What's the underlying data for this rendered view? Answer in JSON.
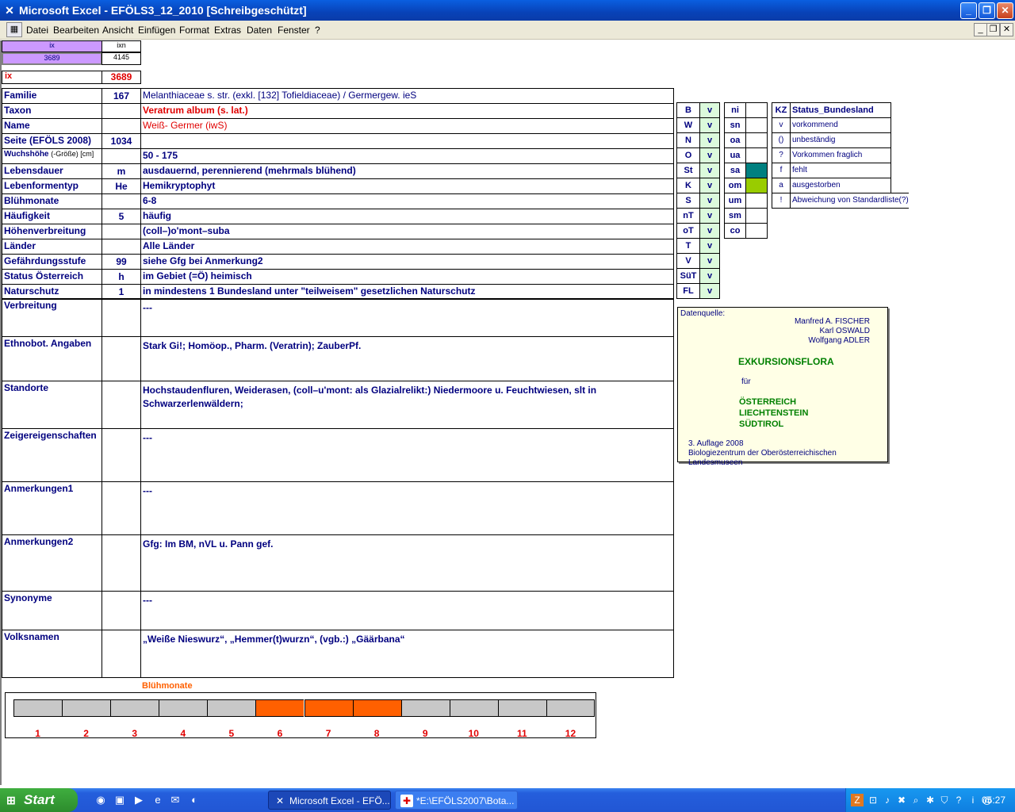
{
  "window": {
    "title": "Microsoft Excel - EFÖLS3_12_2010  [Schreibgeschützt]"
  },
  "menu": [
    "Datei",
    "Bearbeiten",
    "Ansicht",
    "Einfügen",
    "Format",
    "Extras",
    "Daten",
    "Fenster",
    "?"
  ],
  "header": {
    "ix_label": "ix",
    "ixn_label": "ixn",
    "ix_value": "3689",
    "ixn_value": "4145",
    "ix_big_label": "ix",
    "ix_big_value": "3689"
  },
  "rows": [
    {
      "label": "Familie",
      "code": "167",
      "value": "Melanthiaceae s. str. (exkl. [132] Tofieldiaceae)  /  Germergew. ieS"
    },
    {
      "label": "Taxon",
      "code": "",
      "value": "Veratrum album (s. lat.)"
    },
    {
      "label": "Name",
      "code": "",
      "value": "Weiß- Germer (iwS)"
    },
    {
      "label": "Seite (EFÖLS 2008)",
      "code": "1034",
      "value": ""
    },
    {
      "label": "Wuchshöhe",
      "label_small": "(-Größe) [cm]",
      "code": "",
      "value": " 50 - 175"
    },
    {
      "label": "Lebensdauer",
      "code": "m",
      "value": "ausdauernd, perennierend (mehrmals blühend)"
    },
    {
      "label": "Lebenformentyp",
      "code": "He",
      "value": "Hemikryptophyt"
    },
    {
      "label": "Blühmonate",
      "code": "",
      "value": " 6-8"
    },
    {
      "label": "Häufigkeit",
      "code": "5",
      "value": "häufig"
    },
    {
      "label": "Höhenverbreitung",
      "code": "",
      "value": "(coll–)o'mont–suba"
    },
    {
      "label": "Länder",
      "code": "",
      "value": "Alle Länder"
    },
    {
      "label": "Gefährdungsstufe",
      "code": "99",
      "value": "siehe Gfg bei Anmerkung2"
    },
    {
      "label": "Status Österreich",
      "code": "h",
      "value": "im Gebiet (=Ö) heimisch"
    },
    {
      "label": "Naturschutz",
      "code": "1",
      "value": "in mindestens 1 Bundesland unter \"teilweisem\" gesetzlichen Naturschutz"
    }
  ],
  "big_rows": [
    {
      "label": "Verbreitung",
      "value": " ---"
    },
    {
      "label": "Ethnobot. Angaben",
      "value": "Stark Gi!; Homöop., Pharm. (Veratrin); ZauberPf."
    },
    {
      "label": "Standorte",
      "value": "Hochstaudenfluren, Weiderasen, (coll–u'mont: als Glazialrelikt:) Niedermoore u. Feuchtwiesen, slt in Schwarzerlenwäldern;"
    },
    {
      "label": "Zeigereigenschaften",
      "value": "---"
    },
    {
      "label": "Anmerkungen1",
      "value": "---"
    },
    {
      "label": "Anmerkungen2",
      "value": "Gfg: Im BM, nVL u. Pann gef."
    },
    {
      "label": "Synonyme",
      "value": "---"
    },
    {
      "label": "Volksnamen",
      "value": "„Weiße Nieswurz“, „Hemmer(t)wurzn“, (vgb.:) „Gäärbana“"
    }
  ],
  "states": [
    {
      "code": "B",
      "v": "v"
    },
    {
      "code": "W",
      "v": "v"
    },
    {
      "code": "N",
      "v": "v"
    },
    {
      "code": "O",
      "v": "v"
    },
    {
      "code": "St",
      "v": "v"
    },
    {
      "code": "K",
      "v": "v"
    },
    {
      "code": "S",
      "v": "v"
    },
    {
      "code": "nT",
      "v": "v"
    },
    {
      "code": "oT",
      "v": "v"
    },
    {
      "code": "T",
      "v": "v"
    },
    {
      "code": "V",
      "v": "v"
    },
    {
      "code": "SüT",
      "v": "v"
    },
    {
      "code": "FL",
      "v": "v"
    }
  ],
  "regions": [
    {
      "code": "ni",
      "color": ""
    },
    {
      "code": "sn",
      "color": ""
    },
    {
      "code": "oa",
      "color": ""
    },
    {
      "code": "ua",
      "color": ""
    },
    {
      "code": "sa",
      "color": "#008080"
    },
    {
      "code": "om",
      "color": "#99cc00"
    },
    {
      "code": "um",
      "color": ""
    },
    {
      "code": "sm",
      "color": ""
    },
    {
      "code": "co",
      "color": ""
    }
  ],
  "legend": {
    "kz": "KZ",
    "title": "Status_Bundesland",
    "items": [
      {
        "k": "v",
        "t": "vorkommend"
      },
      {
        "k": "()",
        "t": "unbeständig"
      },
      {
        "k": "?",
        "t": "Vorkommen fraglich"
      },
      {
        "k": "f",
        "t": "fehlt"
      },
      {
        "k": "a",
        "t": "ausgestorben"
      },
      {
        "k": "!",
        "t": "Abweichung von Standardliste(?)"
      }
    ]
  },
  "source": {
    "label": "Datenquelle:",
    "authors": [
      "Manfred A. FISCHER",
      "Karl OSWALD",
      "Wolfgang ADLER"
    ],
    "book": "EXKURSIONSFLORA",
    "fuer": "für",
    "countries": [
      "ÖSTERREICH",
      "LIECHTENSTEIN",
      "SÜDTIROL"
    ],
    "edition": "3. Auflage 2008",
    "publisher": "Biologiezentrum der Oberösterreichischen Landesmuseen"
  },
  "chart_data": {
    "type": "bar",
    "title": "Blühmonate",
    "categories": [
      "1",
      "2",
      "3",
      "4",
      "5",
      "6",
      "7",
      "8",
      "9",
      "10",
      "11",
      "12"
    ],
    "values": [
      0,
      0,
      0,
      0,
      0,
      1,
      1,
      1,
      0,
      0,
      0,
      0
    ],
    "colors": {
      "on": "#ff6000",
      "off": "#c8c8c8",
      "label": "#e00000"
    }
  },
  "taskbar": {
    "start": "Start",
    "items": [
      "Microsoft Excel - EFÖ...",
      "*E:\\EFÖLS2007\\Bota..."
    ],
    "clock": "05:27"
  }
}
